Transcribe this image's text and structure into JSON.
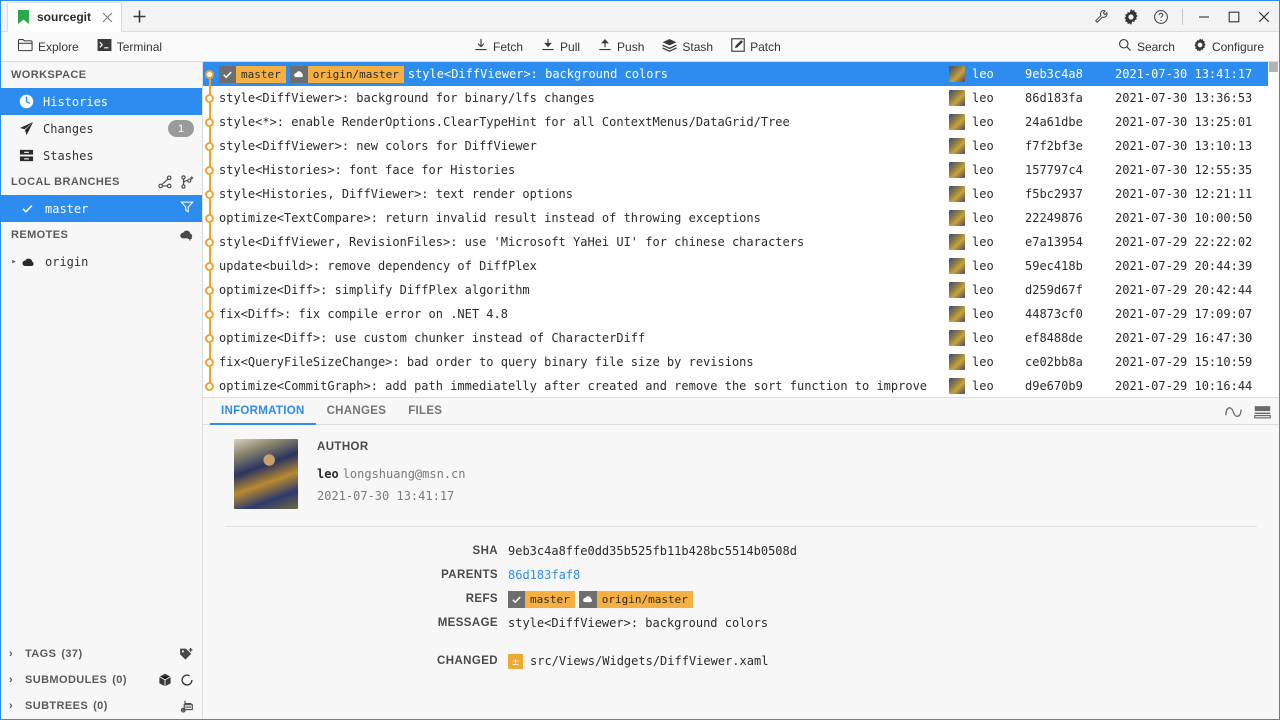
{
  "window": {
    "tab_title": "sourcegit",
    "tab_close_icon": "close-icon",
    "new_tab_icon": "plus-icon",
    "wrench_icon": "wrench-icon",
    "gear_icon": "gear-icon",
    "help_icon": "help-icon",
    "minimize_icon": "minimize-icon",
    "maximize_icon": "maximize-icon",
    "close_icon": "close-icon"
  },
  "toolbar": {
    "left": [
      {
        "label": "Explore",
        "icon": "folder-icon"
      },
      {
        "label": "Terminal",
        "icon": "terminal-icon"
      }
    ],
    "center": [
      {
        "label": "Fetch",
        "icon": "download-icon"
      },
      {
        "label": "Pull",
        "icon": "pull-icon"
      },
      {
        "label": "Push",
        "icon": "push-icon"
      },
      {
        "label": "Stash",
        "icon": "stack-icon"
      },
      {
        "label": "Patch",
        "icon": "patch-icon"
      }
    ],
    "right": [
      {
        "label": "Search",
        "icon": "search-icon"
      },
      {
        "label": "Configure",
        "icon": "gear-icon"
      }
    ]
  },
  "sidebar": {
    "workspace_title": "WORKSPACE",
    "workspace_items": [
      {
        "label": "Histories",
        "icon": "clock-icon",
        "active": true,
        "count": ""
      },
      {
        "label": "Changes",
        "icon": "paperplane-icon",
        "active": false,
        "count": "1"
      },
      {
        "label": "Stashes",
        "icon": "drawer-icon",
        "active": false,
        "count": ""
      }
    ],
    "local_branches_title": "LOCAL BRANCHES",
    "local_branches_icons": [
      "branch-compare-icon",
      "new-branch-icon"
    ],
    "branches": [
      {
        "label": "master",
        "active": true,
        "check_icon": "check-icon",
        "filter_icon": "filter-icon"
      }
    ],
    "remotes_title": "REMOTES",
    "remotes_icon": "add-remote-icon",
    "remotes": [
      {
        "label": "origin",
        "icon": "cloud-icon",
        "caret": "▸"
      }
    ],
    "bottom_groups": [
      {
        "caret": "›",
        "label": "TAGS",
        "count": "(37)",
        "icons": [
          "add-tag-icon"
        ]
      },
      {
        "caret": "›",
        "label": "SUBMODULES",
        "count": "(0)",
        "icons": [
          "cube-icon",
          "refresh-icon"
        ]
      },
      {
        "caret": "›",
        "label": "SUBTREES",
        "count": "(0)",
        "icons": [
          "add-subtree-icon"
        ]
      }
    ]
  },
  "commit_list": {
    "scrollbar": "vertical-scrollbar",
    "rows": [
      {
        "selected": true,
        "refs": [
          {
            "icon": "check-icon",
            "name": "master"
          },
          {
            "icon": "cloud-icon",
            "name": "origin/master"
          }
        ],
        "message": "style<DiffViewer>: background colors",
        "author": "leo",
        "sha": "9eb3c4a8",
        "date": "2021-07-30 13:41:17"
      },
      {
        "selected": false,
        "refs": [],
        "message": "style<DiffViewer>: background for binary/lfs changes",
        "author": "leo",
        "sha": "86d183fa",
        "date": "2021-07-30 13:36:53"
      },
      {
        "selected": false,
        "refs": [],
        "message": "style<*>: enable RenderOptions.ClearTypeHint for all ContextMenus/DataGrid/Tree",
        "author": "leo",
        "sha": "24a61dbe",
        "date": "2021-07-30 13:25:01"
      },
      {
        "selected": false,
        "refs": [],
        "message": "style<DiffViewer>: new colors for DiffViewer",
        "author": "leo",
        "sha": "f7f2bf3e",
        "date": "2021-07-30 13:10:13"
      },
      {
        "selected": false,
        "refs": [],
        "message": "style<Histories>: font face for Histories",
        "author": "leo",
        "sha": "157797c4",
        "date": "2021-07-30 12:55:35"
      },
      {
        "selected": false,
        "refs": [],
        "message": "style<Histories, DiffViewer>: text render options",
        "author": "leo",
        "sha": "f5bc2937",
        "date": "2021-07-30 12:21:11"
      },
      {
        "selected": false,
        "refs": [],
        "message": "optimize<TextCompare>: return invalid result instead of throwing exceptions",
        "author": "leo",
        "sha": "22249876",
        "date": "2021-07-30 10:00:50"
      },
      {
        "selected": false,
        "refs": [],
        "message": "style<DiffViewer, RevisionFiles>: use 'Microsoft YaHei UI' for chinese characters",
        "author": "leo",
        "sha": "e7a13954",
        "date": "2021-07-29 22:22:02"
      },
      {
        "selected": false,
        "refs": [],
        "message": "update<build>: remove dependency of DiffPlex",
        "author": "leo",
        "sha": "59ec418b",
        "date": "2021-07-29 20:44:39"
      },
      {
        "selected": false,
        "refs": [],
        "message": "optimize<Diff>: simplify DiffPlex algorithm",
        "author": "leo",
        "sha": "d259d67f",
        "date": "2021-07-29 20:42:44"
      },
      {
        "selected": false,
        "refs": [],
        "message": "fix<Diff>: fix compile error on .NET 4.8",
        "author": "leo",
        "sha": "44873cf0",
        "date": "2021-07-29 17:09:07"
      },
      {
        "selected": false,
        "refs": [],
        "message": "optimize<Diff>: use custom chunker instead of CharacterDiff",
        "author": "leo",
        "sha": "ef8488de",
        "date": "2021-07-29 16:47:30"
      },
      {
        "selected": false,
        "refs": [],
        "message": "fix<QueryFileSizeChange>: bad order to query binary file size by revisions",
        "author": "leo",
        "sha": "ce02bb8a",
        "date": "2021-07-29 15:10:59"
      },
      {
        "selected": false,
        "refs": [],
        "message": "optimize<CommitGraph>: add path immediatelly after created and remove the sort function to improve perfor",
        "author": "leo",
        "sha": "d9e670b9",
        "date": "2021-07-29 10:16:44"
      }
    ]
  },
  "detail": {
    "tabs": [
      {
        "label": "INFORMATION",
        "active": true
      },
      {
        "label": "CHANGES",
        "active": false
      },
      {
        "label": "FILES",
        "active": false
      }
    ],
    "tab_icons": [
      "graph-curve-icon",
      "layout-split-icon"
    ],
    "author_label": "AUTHOR",
    "author_avatar": "avatar",
    "author_name": "leo",
    "author_email": "longshuang@msn.cn",
    "author_date": "2021-07-30 13:41:17",
    "fields": [
      {
        "key": "SHA",
        "value": "9eb3c4a8ffe0dd35b525fb11b428bc5514b0508d",
        "style": "plain"
      },
      {
        "key": "PARENTS",
        "value": "86d183faf8",
        "style": "link"
      },
      {
        "key": "REFS",
        "value": "",
        "style": "refs"
      },
      {
        "key": "MESSAGE",
        "value": "style<DiffViewer>: background colors",
        "style": "plain"
      }
    ],
    "refs": [
      {
        "icon": "check-icon",
        "name": "master"
      },
      {
        "icon": "cloud-icon",
        "name": "origin/master"
      }
    ],
    "changed_label": "CHANGED",
    "changed_files": [
      {
        "badge": "±",
        "path": "src/Views/Widgets/DiffViewer.xaml"
      }
    ]
  },
  "colors": {
    "accent": "#2d8cf0",
    "graph": "#f3a32a",
    "ref_badge": "#f5b041",
    "ref_icon_bg": "#6e6e6e"
  }
}
